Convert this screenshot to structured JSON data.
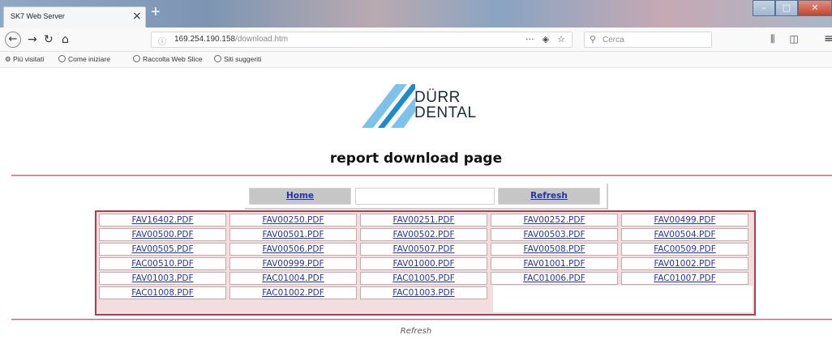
{
  "browser": {
    "tab_title": "SK7 Web Server",
    "url_host": "169.254.190.158",
    "url_path": "/download.htm",
    "search_placeholder": "Cerca",
    "bookmarks": [
      "Più visitati",
      "Come iniziare",
      "Raccolta Web Slice",
      "Siti suggeriti"
    ]
  },
  "logo": {
    "line1": "DÜRR",
    "line2": "DENTAL",
    "colors": {
      "light_blue": "#7cc2ea",
      "blue": "#1e8bd0"
    }
  },
  "page": {
    "heading": "report download page",
    "nav": {
      "home": "Home",
      "refresh": "Refresh"
    },
    "footer_refresh": "Refresh"
  },
  "files": [
    "FAV16402.PDF",
    "FAV00250.PDF",
    "FAV00251.PDF",
    "FAV00252.PDF",
    "FAV00499.PDF",
    "FAV00500.PDF",
    "FAV00501.PDF",
    "FAV00502.PDF",
    "FAV00503.PDF",
    "FAV00504.PDF",
    "FAV00505.PDF",
    "FAV00506.PDF",
    "FAV00507.PDF",
    "FAV00508.PDF",
    "FAC00509.PDF",
    "FAC00510.PDF",
    "FAV00999.PDF",
    "FAV01000.PDF",
    "FAV01001.PDF",
    "FAV01002.PDF",
    "FAV01003.PDF",
    "FAC01004.PDF",
    "FAC01005.PDF",
    "FAC01006.PDF",
    "FAC01007.PDF",
    "FAC01008.PDF",
    "FAC01002.PDF",
    "FAC01003.PDF"
  ],
  "colors": {
    "link": "#1f36a6",
    "table_border": "#a84050",
    "rule": "#c86a78"
  }
}
